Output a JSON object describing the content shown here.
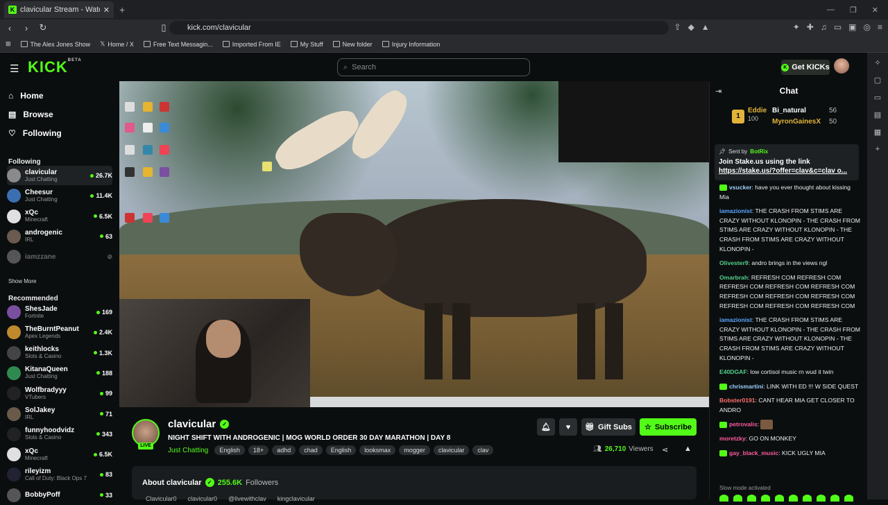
{
  "browser": {
    "tab_title": "clavicular Stream - Watch Live",
    "url": "kick.com/clavicular",
    "bookmarks": [
      "The Alex Jones Show",
      "Home / X",
      "Free Text Messagin...",
      "Imported From IE",
      "My Stuff",
      "New folder",
      "Injury Information"
    ]
  },
  "header": {
    "logo": "KICK",
    "logo_sup": "BETA",
    "search_placeholder": "Search",
    "get_kicks": "Get KICKs"
  },
  "leftnav": {
    "home": "Home",
    "browse": "Browse",
    "following": "Following",
    "following_header": "Following",
    "show_more": "Show More",
    "recommended_header": "Recommended",
    "following_channels": [
      {
        "name": "clavicular",
        "category": "Just Chatting",
        "viewers": "26.7K",
        "color": "#8a8a8a"
      },
      {
        "name": "Cheesur",
        "category": "Just Chatting",
        "viewers": "11.4K",
        "color": "#3b6fb0"
      },
      {
        "name": "xQc",
        "category": "Minecraft",
        "viewers": "6.5K",
        "color": "#e0e0e0"
      },
      {
        "name": "androgenic",
        "category": "IRL",
        "viewers": "63",
        "color": "#6a5a50"
      },
      {
        "name": "iamzzane",
        "category": "",
        "viewers": "",
        "color": "#555555"
      }
    ],
    "recommended_channels": [
      {
        "name": "ShesJade",
        "category": "Fortnite",
        "viewers": "169",
        "color": "#7a4fa0"
      },
      {
        "name": "TheBurntPeanut",
        "category": "Apex Legends",
        "viewers": "2.4K",
        "color": "#c0892e"
      },
      {
        "name": "keithlocks",
        "category": "Slots & Casino",
        "viewers": "1.3K",
        "color": "#444"
      },
      {
        "name": "KitanaQueen",
        "category": "Just Chatting",
        "viewers": "188",
        "color": "#2f8a4f"
      },
      {
        "name": "Wolfbradyyy",
        "category": "VTubers",
        "viewers": "99",
        "color": "#222"
      },
      {
        "name": "SolJakey",
        "category": "IRL",
        "viewers": "71",
        "color": "#6a5a4a"
      },
      {
        "name": "funnyhoodvidz",
        "category": "Slots & Casino",
        "viewers": "343",
        "color": "#222"
      },
      {
        "name": "xQc",
        "category": "Minecraft",
        "viewers": "6.5K",
        "color": "#e0e0e0"
      },
      {
        "name": "rileyizm",
        "category": "Call of Duty: Black Ops 7",
        "viewers": "83",
        "color": "#223"
      },
      {
        "name": "BobbyPoff",
        "category": "",
        "viewers": "33",
        "color": "#555"
      }
    ]
  },
  "stream": {
    "name": "clavicular",
    "live": "LIVE",
    "title": "NIGHT SHIFT WITH ANDROGENIC | MOG WORLD ORDER 30 DAY MARATHON | DAY 8",
    "category": "Just Chatting",
    "tags": [
      "English",
      "18+",
      "adhd",
      "chad",
      "English",
      "looksmax",
      "mogger",
      "clavicular",
      "clav"
    ],
    "gift_subs": "Gift Subs",
    "subscribe": "Subscribe",
    "viewers": "26,710",
    "viewers_label": "Viewers",
    "about_prefix": "About clavicular",
    "followers": "255.6K",
    "followers_label": "Followers",
    "socials": [
      "Clavicular0",
      "clavicular0",
      "@livewithclav",
      "kingclavicular"
    ]
  },
  "chat": {
    "title": "Chat",
    "leaderboard": [
      {
        "name": "Eddie",
        "value": "100"
      },
      {
        "name": "Bi_natural",
        "value": "56"
      },
      {
        "name": "MyronGainesX",
        "value": "50"
      }
    ],
    "pinned": {
      "sent_by": "Sent by",
      "bot": "BotRix",
      "line1": "Join Stake.us using the link",
      "link": "https://stake.us/?offer=clav&c=clav o..."
    },
    "messages": [
      {
        "user": "vsucker",
        "color": "#9ad0ff",
        "text": "have you ever thought about kissing Mia",
        "badge": true
      },
      {
        "user": "iamazionist",
        "color": "#5aa6ff",
        "text": "THE CRASH FROM STIMS ARE CRAZY WITHOUT KLONOPIN - THE CRASH FROM STIMS ARE CRAZY WITHOUT KLONOPIN - THE CRASH FROM STIMS ARE CRAZY WITHOUT KLONOPIN -",
        "badge": false
      },
      {
        "user": "Olivester9",
        "color": "#53d18a",
        "text": "andro brings in the views ngl",
        "badge": false
      },
      {
        "user": "Omarbrah",
        "color": "#53d18a",
        "text": "REFRESH COM REFRESH COM REFRESH COM REFRESH COM REFRESH COM REFRESH COM REFRESH COM REFRESH COM REFRESH COM REFRESH COM REFRESH COM",
        "badge": false
      },
      {
        "user": "iamazionist",
        "color": "#5aa6ff",
        "text": "THE CRASH FROM STIMS ARE CRAZY WITHOUT KLONOPIN - THE CRASH FROM STIMS ARE CRAZY WITHOUT KLONOPIN - THE CRASH FROM STIMS ARE CRAZY WITHOUT KLONOPIN -",
        "badge": false
      },
      {
        "user": "E40DGAF",
        "color": "#53d18a",
        "text": "low cortisol music rn wud it twin",
        "badge": false
      },
      {
        "user": "chrismartini",
        "color": "#9ad0ff",
        "text": "LINK WITH ED !!! W SIDE QUEST",
        "badge": true
      },
      {
        "user": "Bobster0191",
        "color": "#ff7070",
        "text": "CANT HEAR MIA GET CLOSER TO ANDRO",
        "badge": false
      },
      {
        "user": "petrovalis",
        "color": "#ff5aa0",
        "text": "",
        "badge": true
      },
      {
        "user": "moretzky",
        "color": "#ff5aa0",
        "text": "GO ON MONKEY",
        "badge": false
      },
      {
        "user": "gay_black_music",
        "color": "#ff5aa0",
        "text": "KICK UGLY MIA",
        "badge": true
      }
    ],
    "slow_mode": "Slow mode activated"
  }
}
